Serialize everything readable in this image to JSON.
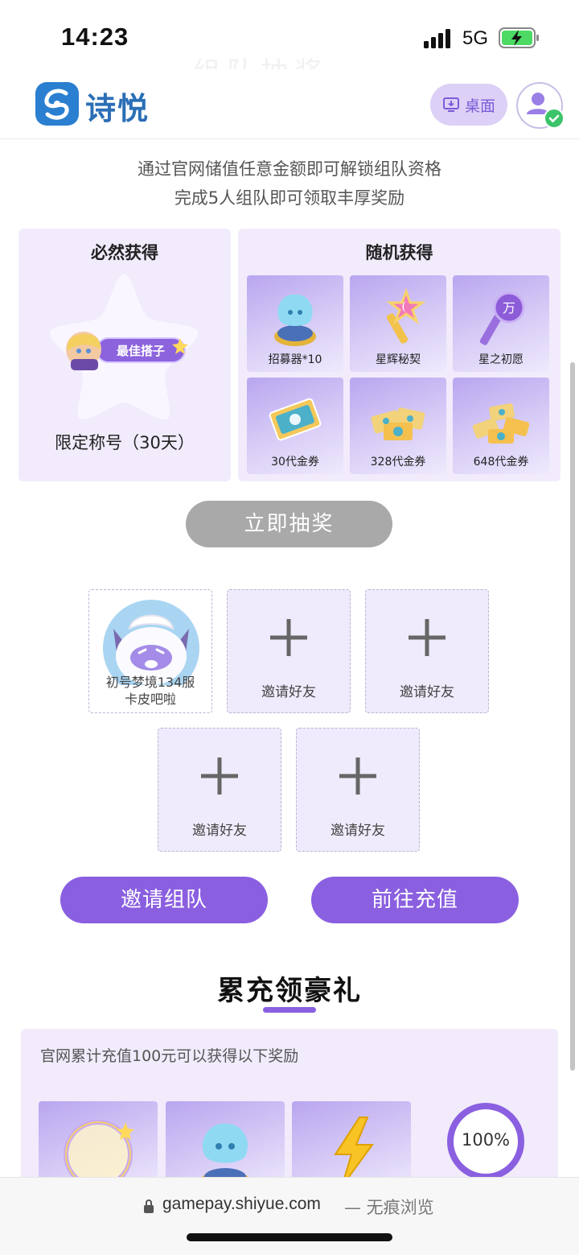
{
  "status_bar": {
    "time": "14:23",
    "network": "5G"
  },
  "header": {
    "brand": "诗悦",
    "desktop_button": "桌面",
    "ghost_text": "组队抽奖"
  },
  "intro": {
    "line1": "通过官网储值任意金额即可解锁组队资格",
    "line2": "完成5人组队即可领取丰厚奖励"
  },
  "guaranteed": {
    "title": "必然获得",
    "badge_text": "最佳搭子",
    "reward": "限定称号（30天）"
  },
  "random": {
    "title": "随机获得",
    "items": [
      {
        "label": "招募器*10",
        "icon": "recruiter-icon"
      },
      {
        "label": "星辉秘契",
        "icon": "star-key-icon"
      },
      {
        "label": "星之初愿",
        "icon": "purple-key-icon"
      },
      {
        "label": "30代金券",
        "icon": "voucher-icon"
      },
      {
        "label": "328代金券",
        "icon": "voucher-stack-icon"
      },
      {
        "label": "648代金券",
        "icon": "voucher-pile-icon"
      }
    ]
  },
  "draw_button": "立即抽奖",
  "team": {
    "member": {
      "name_line1": "初号梦境134服",
      "name_line2": "卡皮吧啦"
    },
    "invite_label": "邀请好友"
  },
  "actions": {
    "invite_team": "邀请组队",
    "recharge": "前往充值"
  },
  "cumulative": {
    "title": "累充领豪礼",
    "description": "官网累计充值100元可以获得以下奖励",
    "progress": "100%",
    "progress_value": 1.0,
    "items": [
      "frame-icon",
      "recruiter-icon",
      "lightning-icon"
    ]
  },
  "browser": {
    "url": "gamepay.shiyue.com",
    "mode": "— 无痕浏览"
  },
  "colors": {
    "accent": "#8a5fe0",
    "panel": "#f1ebfc",
    "disabled": "#a9a9a9"
  }
}
